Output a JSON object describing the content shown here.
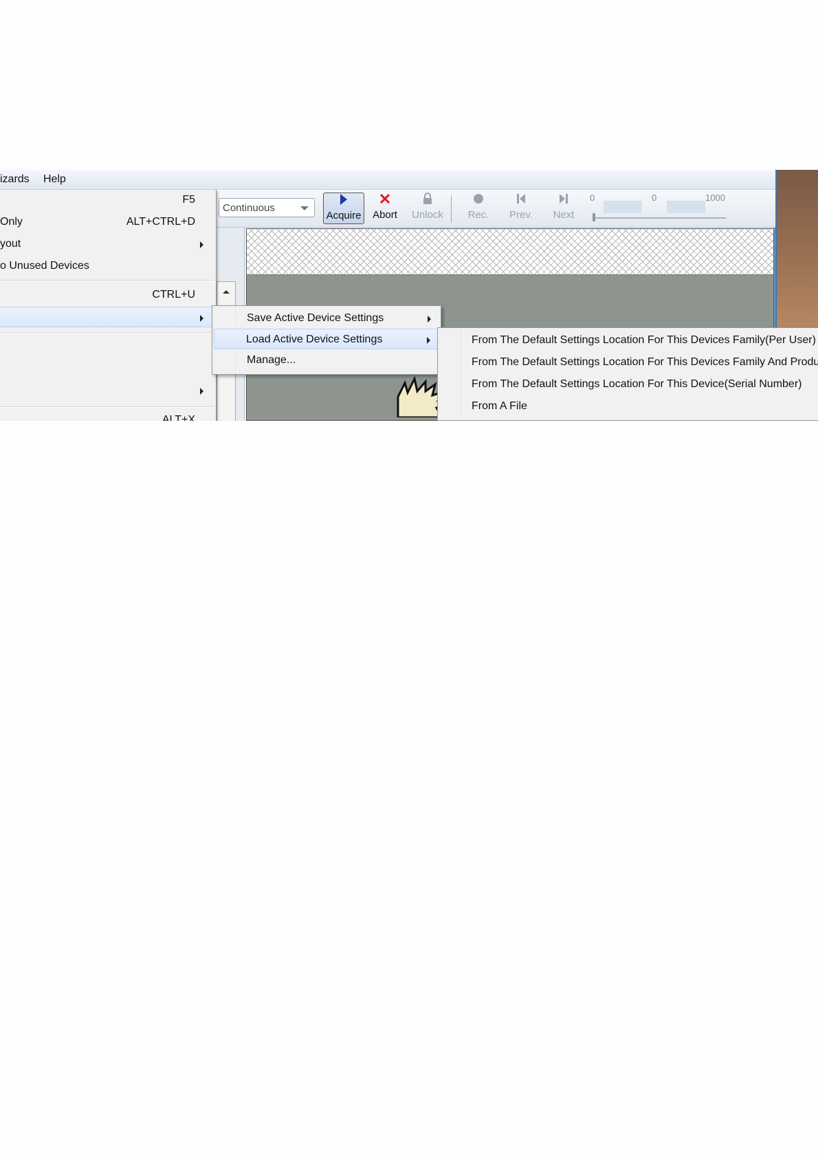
{
  "menubar": {
    "items": [
      {
        "label": "izards"
      },
      {
        "label": "Help"
      }
    ]
  },
  "toolbar": {
    "mode_value": "Continuous",
    "buttons": [
      {
        "label": "Acquire",
        "icon": "play-icon",
        "state": "active"
      },
      {
        "label": "Abort",
        "icon": "close-icon",
        "state": "enabled"
      },
      {
        "label": "Unlock",
        "icon": "lock-icon",
        "state": "disabled"
      },
      {
        "label": "Rec.",
        "icon": "record-icon",
        "state": "disabled"
      },
      {
        "label": "Prev.",
        "icon": "previous-icon",
        "state": "disabled"
      },
      {
        "label": "Next",
        "icon": "next-icon",
        "state": "disabled"
      }
    ],
    "range": {
      "min": "0",
      "current": "0",
      "max": "1000"
    }
  },
  "main_menu": {
    "items": [
      {
        "label": "",
        "shortcut": "F5"
      },
      {
        "label": "Only",
        "shortcut": "ALT+CTRL+D"
      },
      {
        "label": "yout",
        "shortcut": ""
      },
      {
        "label": "o Unused Devices",
        "shortcut": ""
      },
      {
        "label": "",
        "shortcut": "CTRL+U"
      },
      {
        "label": "",
        "shortcut": ""
      },
      {
        "label": "",
        "shortcut": ""
      },
      {
        "label": "",
        "shortcut": "ALT+X"
      }
    ]
  },
  "settings_menu": {
    "items": [
      {
        "label": "Save Active Device Settings"
      },
      {
        "label": "Load Active Device Settings"
      },
      {
        "label": "Manage..."
      }
    ]
  },
  "load_menu": {
    "items": [
      {
        "label": "From The Default Settings Location For This Devices Family(Per User)"
      },
      {
        "label": "From The Default Settings Location For This Devices Family And Product"
      },
      {
        "label": "From The Default Settings Location For This Device(Serial Number)"
      },
      {
        "label": "From A File"
      }
    ]
  },
  "colors": {
    "accent": "#1a3aa0",
    "abort": "#e8121a",
    "highlight": "#d9e8fb"
  }
}
